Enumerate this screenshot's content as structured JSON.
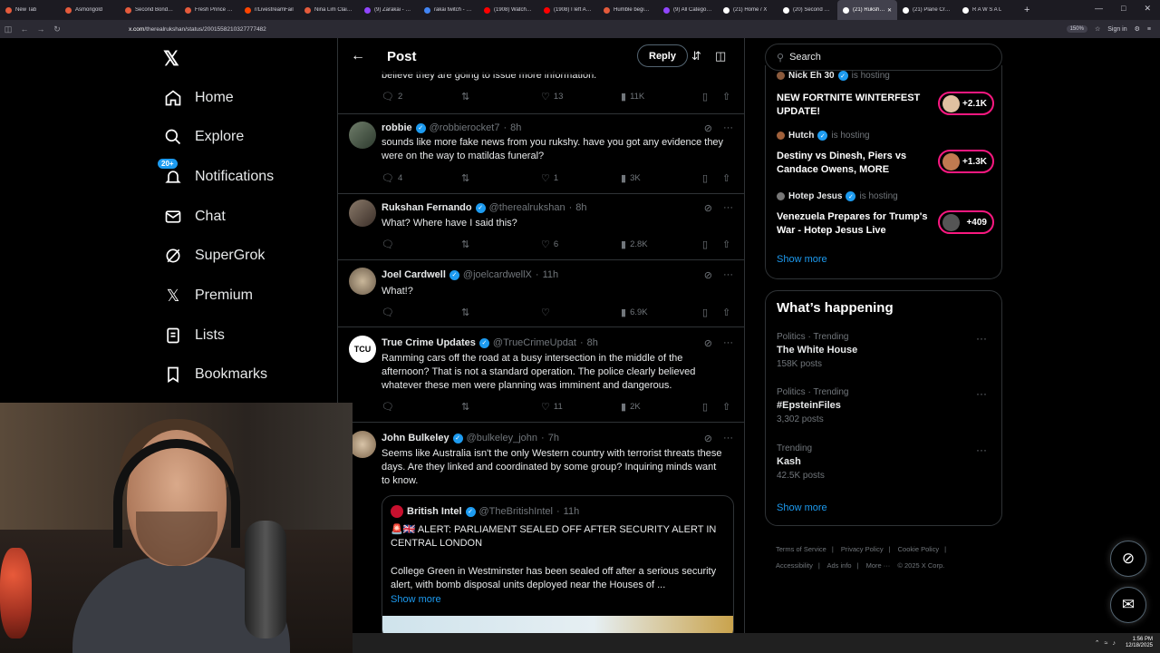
{
  "browser": {
    "tabs": [
      {
        "label": "New Tab",
        "color": "#e55b3c"
      },
      {
        "label": "Asmongold",
        "color": "#e55b3c"
      },
      {
        "label": "Second Bondi Te",
        "color": "#e55b3c"
      },
      {
        "label": "Fresh Prince of B",
        "color": "#e55b3c"
      },
      {
        "label": "r/LivestreamFail",
        "color": "#ff4500"
      },
      {
        "label": "Nina Lim Claims",
        "color": "#e55b3c"
      },
      {
        "label": "(9) Zarakai - Twit",
        "color": "#9146ff"
      },
      {
        "label": "rakai twitch - Go",
        "color": "#4285f4"
      },
      {
        "label": "(1908) Watch late",
        "color": "#ff0000"
      },
      {
        "label": "(1908) I left Auth",
        "color": "#ff0000"
      },
      {
        "label": "Humble beginnin",
        "color": "#e55b3c"
      },
      {
        "label": "(9) All Categorie",
        "color": "#9146ff"
      },
      {
        "label": "(21) Home / X",
        "color": "#ffffff"
      },
      {
        "label": "(20) Second Bond",
        "color": "#ffffff"
      },
      {
        "label": "(21) Rukshan F",
        "color": "#ffffff"
      },
      {
        "label": "(21) Plane Crash",
        "color": "#ffffff"
      },
      {
        "label": "R A W S A L",
        "color": "#ffffff"
      }
    ],
    "url_domain": "x.com",
    "url_path": "/therealrukshan/status/2001558210327777482",
    "zoom": "150%",
    "signin": "Sign in"
  },
  "sidebar": {
    "items": [
      {
        "label": "Home"
      },
      {
        "label": "Explore"
      },
      {
        "label": "Notifications",
        "badge": "20+"
      },
      {
        "label": "Chat"
      },
      {
        "label": "SuperGrok"
      },
      {
        "label": "Premium"
      },
      {
        "label": "Lists"
      },
      {
        "label": "Bookmarks"
      }
    ]
  },
  "header": {
    "title": "Post",
    "reply_button": "Reply"
  },
  "top_fragment": {
    "text": "believe they are going to issue more information.",
    "replies": "2",
    "likes": "13",
    "views": "11K"
  },
  "replies": [
    {
      "name": "robbie",
      "handle": "@robbierocket7",
      "time": "8h",
      "verified": true,
      "text": "sounds like more fake news from you rukshy. have you got any evidence they were on the way to matildas funeral?",
      "replies": "4",
      "reposts": "",
      "likes": "1",
      "views": "3K"
    },
    {
      "name": "Rukshan Fernando",
      "handle": "@therealrukshan",
      "time": "8h",
      "verified": true,
      "text": "What? Where have I said this?",
      "replies": "",
      "reposts": "",
      "likes": "6",
      "views": "2.8K"
    },
    {
      "name": "Joel Cardwell",
      "handle": "@joelcardwellX",
      "time": "11h",
      "verified": true,
      "text": "What!?",
      "replies": "",
      "reposts": "",
      "likes": "",
      "views": "6.9K"
    },
    {
      "name": "True Crime Updates",
      "handle": "@TrueCrimeUpdat",
      "time": "8h",
      "verified": true,
      "avatar_text": "TCU",
      "text": "Ramming cars off the road at a busy intersection in the middle of the afternoon? That is not a standard operation. The police clearly believed whatever these men were planning was imminent and dangerous.",
      "replies": "",
      "reposts": "",
      "likes": "11",
      "views": "2K"
    },
    {
      "name": "John Bulkeley",
      "handle": "@bulkeley_john",
      "time": "7h",
      "verified": true,
      "text": "Seems like Australia isn't the only Western country with terrorist threats these days. Are they linked and coordinated by some group? Inquiring minds want to know."
    }
  ],
  "quote": {
    "name": "British Intel",
    "handle": "@TheBritishIntel",
    "time": "11h",
    "headline": "🚨🇬🇧 ALERT: PARLIAMENT SEALED OFF AFTER SECURITY ALERT IN CENTRAL LONDON",
    "body": "College Green in Westminster has been sealed off after a serious security alert, with bomb disposal units deployed near the Houses of ...",
    "show_more": "Show more"
  },
  "search": {
    "placeholder": "Search"
  },
  "spaces": [
    {
      "host": "Nick Eh 30",
      "status": "is hosting",
      "title": "NEW FORTNITE WINTERFEST UPDATE!",
      "listeners": "+2.1K"
    },
    {
      "host": "Hutch",
      "status": "is hosting",
      "title": "Destiny vs Dinesh, Piers vs Candace Owens, MORE",
      "listeners": "+1.3K"
    },
    {
      "host": "Hotep Jesus",
      "status": "is hosting",
      "title": "Venezuela Prepares for Trump's War - Hotep Jesus Live",
      "listeners": "+409"
    }
  ],
  "spaces_show_more": "Show more",
  "happening": {
    "title": "What’s happening",
    "trends": [
      {
        "category": "Politics · Trending",
        "name": "The White House",
        "count": "158K posts"
      },
      {
        "category": "Politics · Trending",
        "name": "#EpsteinFiles",
        "count": "3,302 posts"
      },
      {
        "category": "Trending",
        "name": "Kash",
        "count": "42.5K posts"
      }
    ],
    "show_more": "Show more"
  },
  "footer": {
    "links": [
      "Terms of Service",
      "Privacy Policy",
      "Cookie Policy",
      "Accessibility",
      "Ads info",
      "More ···",
      "© 2025 X Corp."
    ]
  },
  "taskbar": {
    "time": "1:56 PM",
    "date": "12/18/2025"
  },
  "colors": {
    "accent": "#1d9bf0",
    "like_pink": "#f91880",
    "bg": "#000000",
    "border": "#2f3336",
    "muted": "#71767b"
  }
}
